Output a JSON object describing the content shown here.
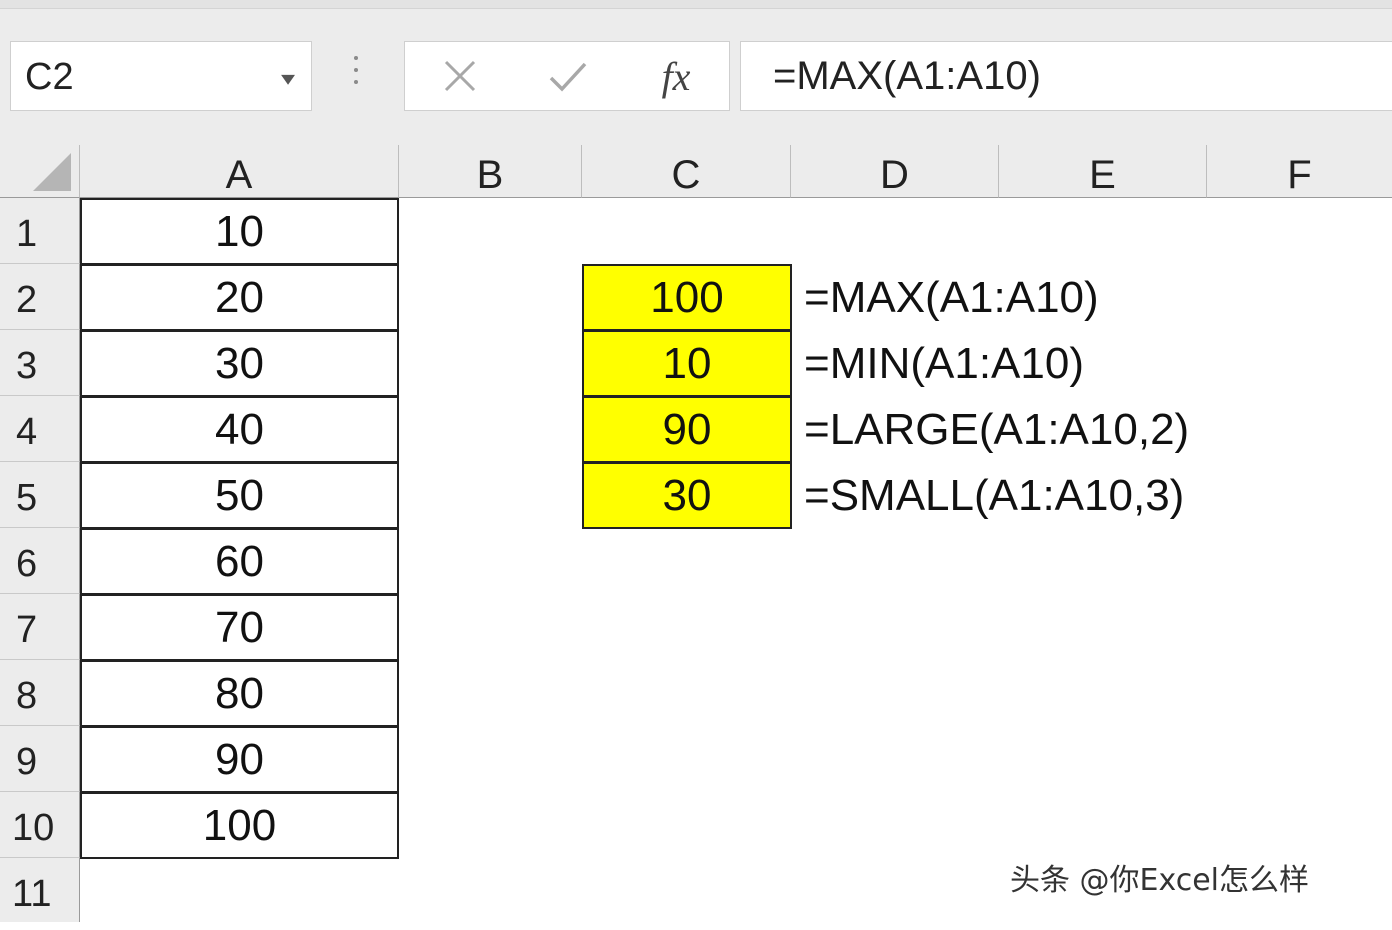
{
  "name_box": {
    "value": "C2"
  },
  "formula_bar": {
    "cancel_icon": "close-icon",
    "enter_icon": "check-icon",
    "fx_label": "fx",
    "formula": "=MAX(A1:A10)"
  },
  "columns": [
    "A",
    "B",
    "C",
    "D",
    "E",
    "F"
  ],
  "rows": [
    "1",
    "2",
    "3",
    "4",
    "5",
    "6",
    "7",
    "8",
    "9",
    "10",
    "11"
  ],
  "column_a": [
    "10",
    "20",
    "30",
    "40",
    "50",
    "60",
    "70",
    "80",
    "90",
    "100"
  ],
  "results": [
    {
      "value": "100",
      "formula": "=MAX(A1:A10)"
    },
    {
      "value": "10",
      "formula": "=MIN(A1:A10)"
    },
    {
      "value": "90",
      "formula": "=LARGE(A1:A10,2)"
    },
    {
      "value": "30",
      "formula": "=SMALL(A1:A10,3)"
    }
  ],
  "highlight_color": "#FFFF00",
  "watermark": "头条 @你Excel怎么样"
}
